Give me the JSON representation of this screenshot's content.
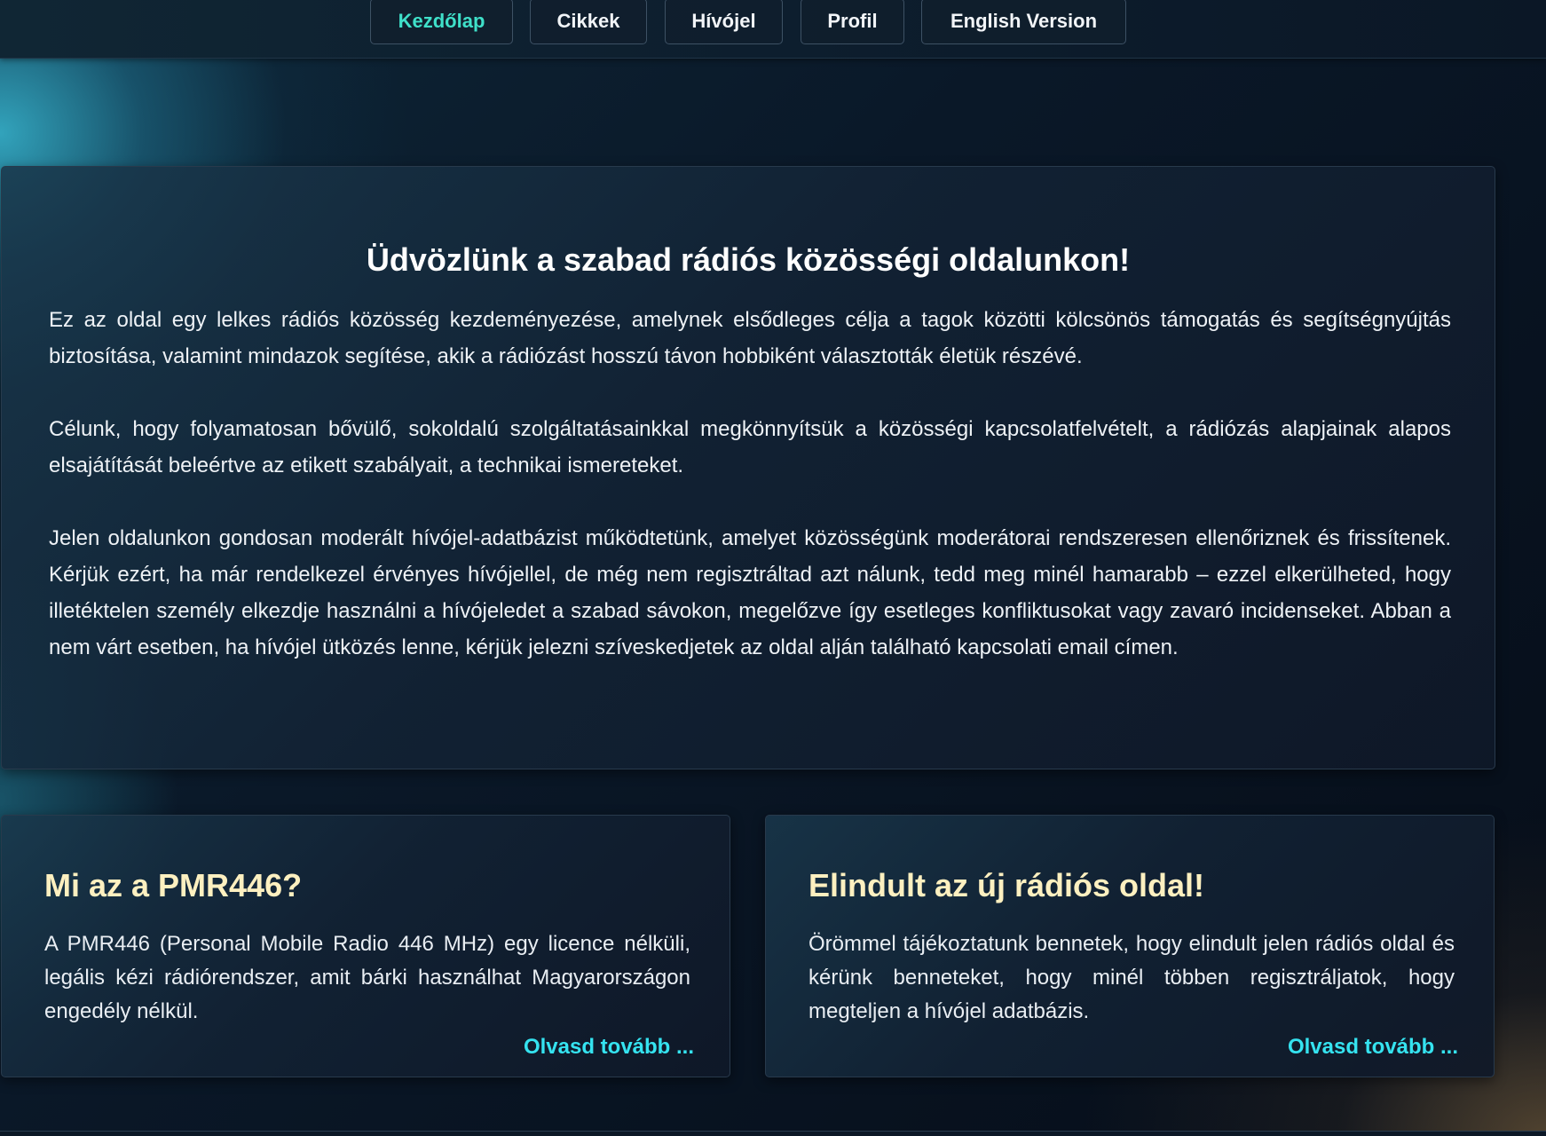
{
  "nav": {
    "items": [
      {
        "label": "Kezdőlap",
        "active": true
      },
      {
        "label": "Cikkek",
        "active": false
      },
      {
        "label": "Hívójel",
        "active": false
      },
      {
        "label": "Profil",
        "active": false
      },
      {
        "label": "English Version",
        "active": false
      }
    ]
  },
  "hero": {
    "title": "Üdvözlünk a szabad rádiós közösségi oldalunkon!",
    "paragraphs": [
      "Ez az oldal egy lelkes rádiós közösség kezdeményezése, amelynek elsődleges célja a tagok közötti kölcsönös támogatás és segítségnyújtás biztosítása, valamint mindazok segítése, akik a rádiózást hosszú távon hobbiként választották életük részévé.",
      "Célunk, hogy folyamatosan bővülő, sokoldalú szolgáltatásainkkal megkönnyítsük a közösségi kapcsolatfelvételt, a rádiózás alapjainak alapos elsajátítását beleértve az etikett szabályait, a technikai ismereteket.",
      "Jelen oldalunkon gondosan moderált hívójel-adatbázist működtetünk, amelyet közösségünk moderátorai rendszeresen ellenőriznek és frissítenek. Kérjük ezért, ha már rendelkezel érvényes hívójellel, de még nem regisztráltad azt nálunk, tedd meg minél hamarabb – ezzel elkerülheted, hogy illetéktelen személy elkezdje használni a hívójeledet a szabad sávokon, megelőzve így esetleges konfliktusokat vagy zavaró incidenseket. Abban a nem várt esetben, ha hívójel ütközés lenne, kérjük jelezni szíveskedjetek az oldal alján található kapcsolati email címen."
    ]
  },
  "cards": [
    {
      "title": "Mi az a PMR446?",
      "text": "A PMR446 (Personal Mobile Radio 446 MHz) egy licence nélküli, legális kézi rádiórendszer, amit bárki használhat Magyarországon engedély nélkül.",
      "link": "Olvasd tovább ..."
    },
    {
      "title": "Elindult az új rádiós oldal!",
      "text": "Örömmel tájékoztatunk bennetek, hogy elindult jelen rádiós oldal és kérünk benneteket, hogy minél többen regisztráljatok, hogy megteljen a hívójel adatbázis.",
      "link": "Olvasd tovább ..."
    }
  ],
  "colors": {
    "accent": "#3fe0c9",
    "link": "#35e3f0",
    "card_title": "#fdf0c0",
    "background": "#07101c"
  }
}
